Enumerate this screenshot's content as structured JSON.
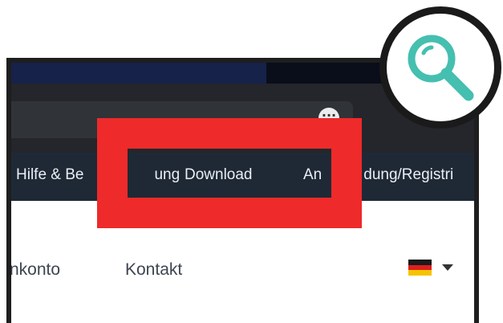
{
  "navbar": {
    "help": "Hilfe & Be",
    "help_tail": "ung",
    "download": "Download",
    "login_head": "An",
    "login_tail": "dung/Registri"
  },
  "subnav": {
    "konto": "nkonto",
    "kontakt": "Kontakt"
  },
  "icons": {
    "magnifier": "search-icon",
    "extension": "more-icon",
    "flag": "german-flag-icon",
    "caret": "chevron-down-icon"
  },
  "colors": {
    "highlight": "#ee2a2a",
    "accent": "#4fc9b5",
    "navbar_bg": "#1f2936"
  }
}
